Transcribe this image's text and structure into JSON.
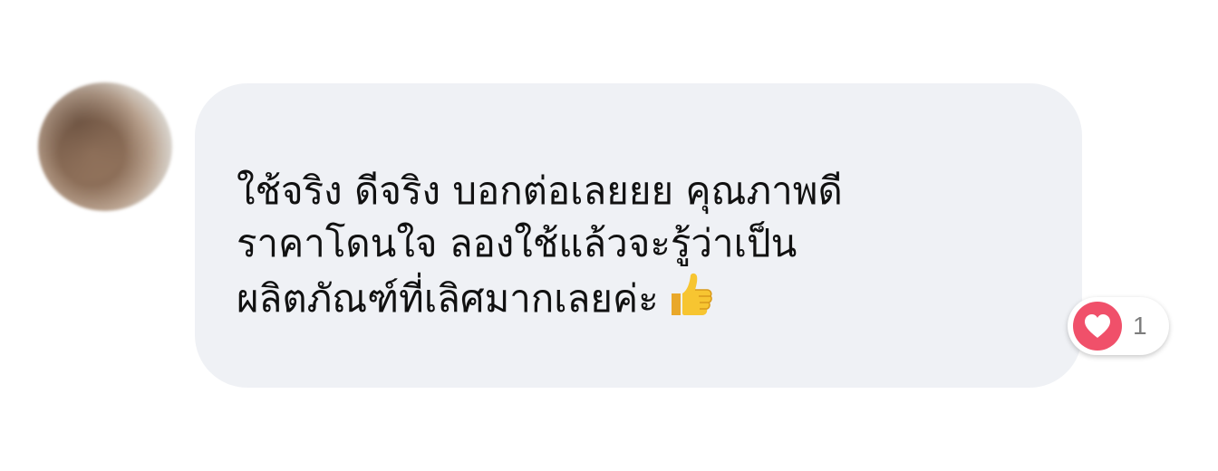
{
  "comment": {
    "lines": [
      "ใช้จริง ดีจริง บอกต่อเลยยย คุณภาพดี",
      "ราคาโดนใจ ลองใช้แล้วจะรู้ว่าเป็น",
      "ผลิตภัณฑ์ที่เลิศมากเลยค่ะ"
    ],
    "emoji": "thumbs-up-icon"
  },
  "avatar": {
    "state": "blurred"
  },
  "reaction": {
    "icon": "heart-icon",
    "count": "1",
    "badge_color": "#f0506a"
  },
  "colors": {
    "bubble": "#eff1f5",
    "text": "#111111",
    "count_text": "#7d7d7d"
  }
}
